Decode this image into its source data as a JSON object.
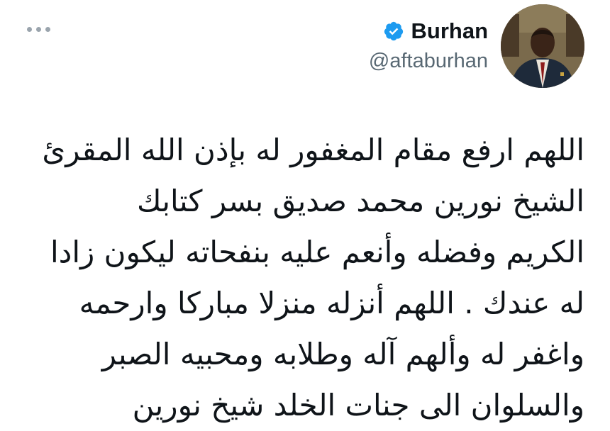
{
  "profile": {
    "display_name": "Burhan",
    "handle": "@aftaburhan",
    "verified": true,
    "avatar_icon": "profile-photo",
    "verified_icon": "verified-badge-icon",
    "more_icon": "more-options-icon"
  },
  "tweet": {
    "lines": [
      "اللهم ارفع مقام المغفور له بإذن الله المقرئ",
      "الشيخ نورين محمد صديق بسر كتابك",
      "الكريم وفضله وأنعم عليه بنفحاته ليكون زادا",
      "له عندك . اللهم أنزله منزلا مباركا وارحمه",
      "واغفر له وألهم آله وطلابه ومحبيه الصبر",
      "والسلوان الى جنات الخلد شيخ نورين"
    ]
  },
  "colors": {
    "accent": "#1d9bf0",
    "text": "#0f1419",
    "secondary": "#586873"
  }
}
